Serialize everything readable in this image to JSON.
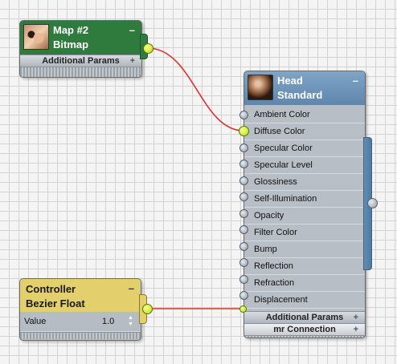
{
  "bitmap_node": {
    "title": "Map #2",
    "subtitle": "Bitmap",
    "minimize": "–",
    "params_label": "Additional Params",
    "params_expand": "+",
    "header_color": "#2f7a3d"
  },
  "material_node": {
    "title": "Head",
    "subtitle": "Standard",
    "minimize": "–",
    "header_color": "#6a8fb5",
    "slots": [
      {
        "label": "Ambient Color"
      },
      {
        "label": "Diffuse Color"
      },
      {
        "label": "Specular Color"
      },
      {
        "label": "Specular Level"
      },
      {
        "label": "Glossiness"
      },
      {
        "label": "Self-Illumination"
      },
      {
        "label": "Opacity"
      },
      {
        "label": "Filter Color"
      },
      {
        "label": "Bump"
      },
      {
        "label": "Reflection"
      },
      {
        "label": "Refraction"
      },
      {
        "label": "Displacement"
      }
    ],
    "params_label": "Additional Params",
    "params_expand": "+",
    "mr_label": "mr Connection",
    "mr_expand": "+"
  },
  "controller_node": {
    "title": "Controller",
    "subtitle": "Bezier Float",
    "minimize": "–",
    "value_label": "Value",
    "value": "1.0",
    "spinner": "▲▼",
    "header_color": "#e3cf6b"
  },
  "colors": {
    "wire": "#e0302c",
    "socket_active": "#c8f000",
    "grid_line": "#d3d3d3"
  }
}
